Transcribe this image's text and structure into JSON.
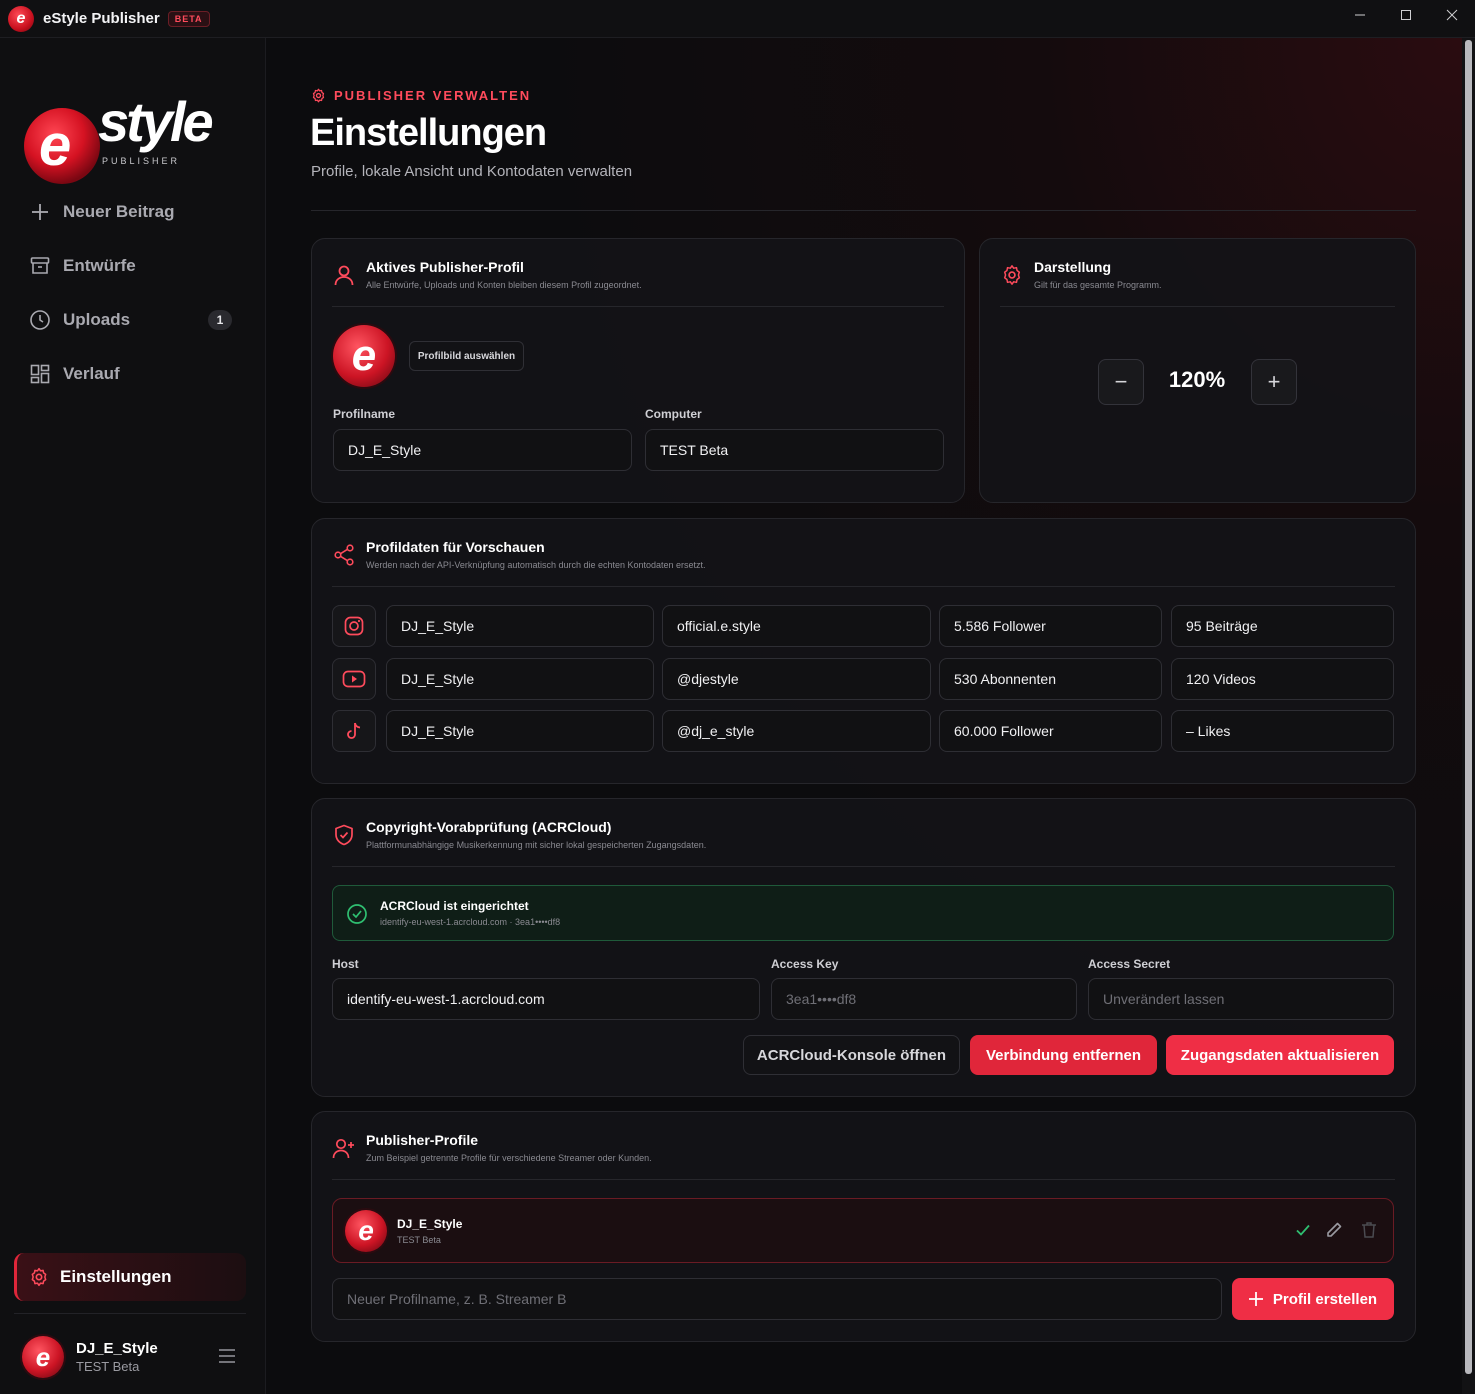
{
  "app": {
    "title": "eStyle Publisher",
    "badge": "BETA"
  },
  "window": {
    "minimize_icon": "minimize-icon",
    "maximize_icon": "maximize-icon",
    "close_icon": "close-icon"
  },
  "sidebar": {
    "logo_text": "style",
    "logo_sub": "PUBLISHER",
    "items": [
      {
        "label": "Neuer Beitrag",
        "icon": "plus-icon"
      },
      {
        "label": "Entwürfe",
        "icon": "archive-icon"
      },
      {
        "label": "Uploads",
        "icon": "clock-icon",
        "count": "1"
      },
      {
        "label": "Verlauf",
        "icon": "grid-icon"
      }
    ],
    "active": {
      "label": "Einstellungen",
      "icon": "gear-icon"
    },
    "user": {
      "name": "DJ_E_Style",
      "sub": "TEST Beta"
    }
  },
  "header": {
    "eyebrow": "PUBLISHER VERWALTEN",
    "title": "Einstellungen",
    "subtitle": "Profile, lokale Ansicht und Kontodaten verwalten"
  },
  "active_profile": {
    "title": "Aktives Publisher-Profil",
    "desc": "Alle Entwürfe, Uploads und Konten bleiben diesem Profil zugeordnet.",
    "choose_image": "Profilbild auswählen",
    "profile_label": "Profilname",
    "profile_value": "DJ_E_Style",
    "computer_label": "Computer",
    "computer_value": "TEST Beta"
  },
  "display": {
    "title": "Darstellung",
    "desc": "Gilt für das gesamte Programm.",
    "zoom": "120%",
    "minus": "−",
    "plus": "+"
  },
  "preview": {
    "title": "Profildaten für Vorschauen",
    "desc": "Werden nach der API-Verknüpfung automatisch durch die echten Kontodaten ersetzt.",
    "rows": [
      {
        "icon": "instagram-icon",
        "name": "DJ_E_Style",
        "handle": "official.e.style",
        "stat1": "5.586 Follower",
        "stat2": "95 Beiträge"
      },
      {
        "icon": "youtube-icon",
        "name": "DJ_E_Style",
        "handle": "@djestyle",
        "stat1": "530 Abonnenten",
        "stat2": "120 Videos"
      },
      {
        "icon": "tiktok-icon",
        "name": "DJ_E_Style",
        "handle": "@dj_e_style",
        "stat1": "60.000 Follower",
        "stat2": "– Likes"
      }
    ]
  },
  "acr": {
    "title": "Copyright-Vorabprüfung (ACRCloud)",
    "desc": "Plattformunabhängige Musikerkennung mit sicher lokal gespeicherten Zugangsdaten.",
    "status_title": "ACRCloud ist eingerichtet",
    "status_sub": "identify-eu-west-1.acrcloud.com · 3ea1••••df8",
    "host_label": "Host",
    "host_value": "identify-eu-west-1.acrcloud.com",
    "key_label": "Access Key",
    "key_placeholder": "3ea1••••df8",
    "secret_label": "Access Secret",
    "secret_placeholder": "Unverändert lassen",
    "btn_console": "ACRCloud-Konsole öffnen",
    "btn_remove": "Verbindung entfernen",
    "btn_update": "Zugangsdaten aktualisieren"
  },
  "profiles": {
    "title": "Publisher-Profile",
    "desc": "Zum Beispiel getrennte Profile für verschiedene Streamer oder Kunden.",
    "item": {
      "name": "DJ_E_Style",
      "sub": "TEST Beta"
    },
    "new_placeholder": "Neuer Profilname, z. B. Streamer B",
    "create": "Profil erstellen"
  },
  "colors": {
    "accent": "#e0263a",
    "accent_text": "#ff4b5c",
    "success": "#2fbf71"
  }
}
